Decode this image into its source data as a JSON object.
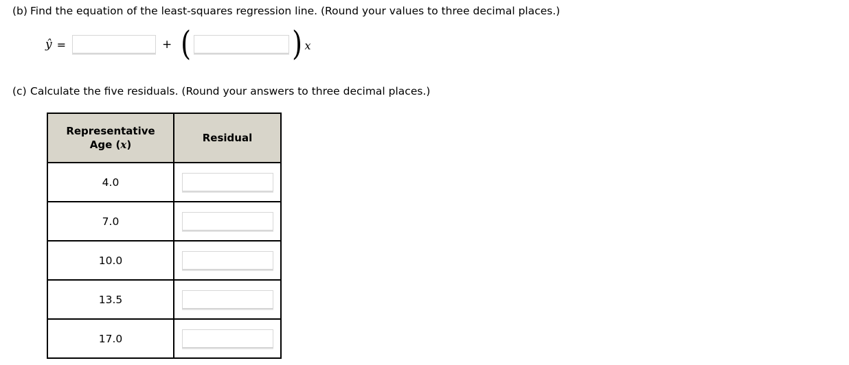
{
  "page": {
    "background": "#ffffff"
  },
  "part_b": {
    "label": "(b)",
    "text": "Find the equation of the least-squares regression line. (Round your values to three decimal places.)",
    "equation": {
      "yhat_symbol": "ŷ",
      "equals": "=",
      "plus": "+",
      "paren_open": "(",
      "paren_close": ")",
      "x_symbol": "x",
      "intercept_value": "",
      "intercept_placeholder": "",
      "slope_value": "",
      "slope_placeholder": ""
    }
  },
  "part_c": {
    "label": "(c)",
    "text": "Calculate the five residuals. (Round your answers to three decimal places.)",
    "table": {
      "headers": {
        "age_line1": "Representative",
        "age_line2_prefix": "Age (",
        "age_line2_var": "x",
        "age_line2_suffix": ")",
        "residual": "Residual"
      },
      "rows": [
        {
          "age": "4.0",
          "residual_value": "",
          "residual_placeholder": ""
        },
        {
          "age": "7.0",
          "residual_value": "",
          "residual_placeholder": ""
        },
        {
          "age": "10.0",
          "residual_value": "",
          "residual_placeholder": ""
        },
        {
          "age": "13.5",
          "residual_value": "",
          "residual_placeholder": ""
        },
        {
          "age": "17.0",
          "residual_value": "",
          "residual_placeholder": ""
        }
      ]
    }
  },
  "colors": {
    "header_fill": "#d8d5ca",
    "border": "#000000",
    "input_border": "#d7d7d7",
    "input_shadow": "#e2e2e2",
    "text": "#000000"
  }
}
